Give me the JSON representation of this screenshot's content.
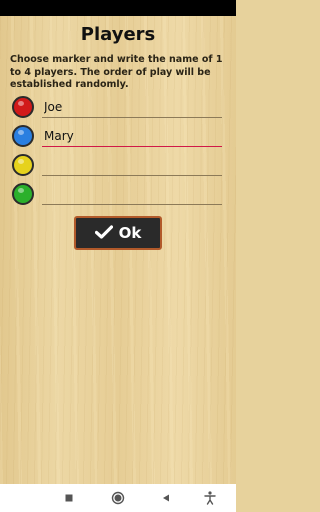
{
  "header": {
    "title": "Players"
  },
  "instructions": "Choose marker and write the name of 1 to 4 players. The order of play will be established randomly.",
  "players": [
    {
      "marker_color": "#d11a1a",
      "name": "Joe",
      "placeholder": ""
    },
    {
      "marker_color": "#2a7fe0",
      "name": "Mary",
      "placeholder": ""
    },
    {
      "marker_color": "#e6d21c",
      "name": "",
      "placeholder": ""
    },
    {
      "marker_color": "#2bb02b",
      "name": "",
      "placeholder": ""
    }
  ],
  "ok_button": {
    "label": "Ok",
    "icon": "check-icon"
  },
  "nav_bar": {
    "items": [
      "recents-square-icon",
      "home-circle-icon",
      "back-triangle-icon",
      "accessibility-icon"
    ]
  },
  "colors": {
    "focus_underline": "#d01848",
    "button_border": "#b25a2a",
    "button_bg": "#2a2a2a"
  }
}
